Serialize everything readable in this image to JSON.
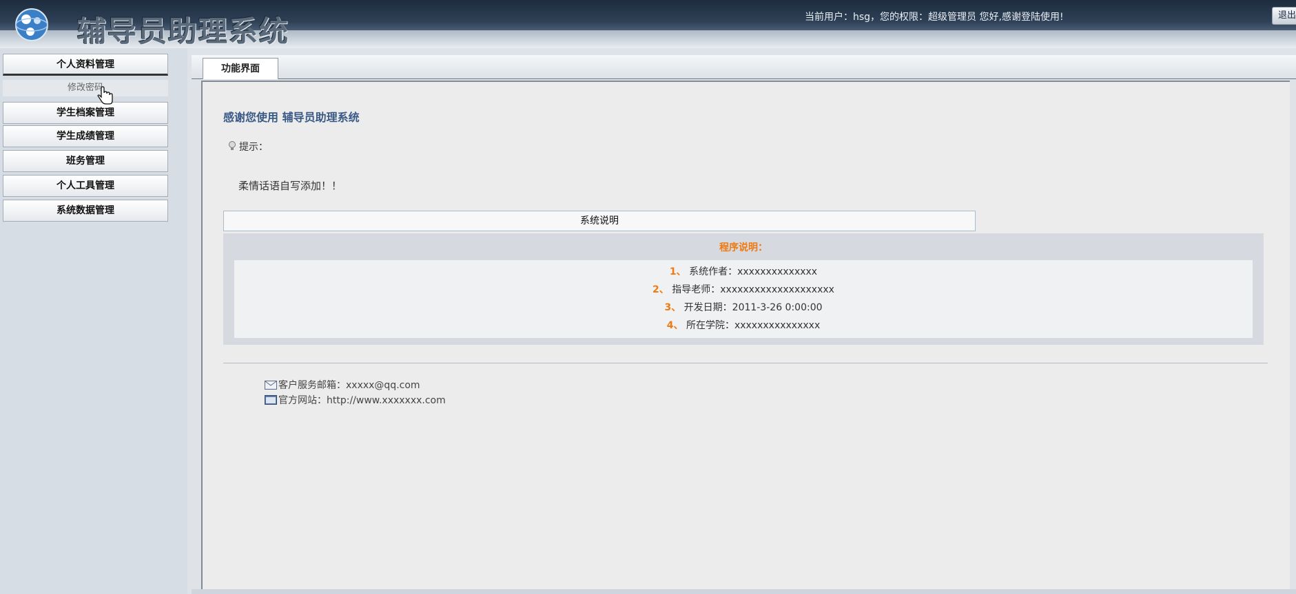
{
  "header": {
    "app_title": "辅导员助理系统",
    "user_info": "当前用户：hsg，您的权限：超级管理员 您好,感谢登陆使用!",
    "logout_label": "退出"
  },
  "sidebar": {
    "items": [
      {
        "label": "个人资料管理"
      },
      {
        "label": "学生档案管理"
      },
      {
        "label": "学生成绩管理"
      },
      {
        "label": "班务管理"
      },
      {
        "label": "个人工具管理"
      },
      {
        "label": "系统数据管理"
      }
    ],
    "sub_item": "修改密码"
  },
  "main": {
    "tab_label": "功能界面",
    "welcome": "感谢您使用  辅导员助理系统",
    "tip_label": "提示：",
    "tip_text": "柔情话语自写添加！！",
    "section_header": "系统说明",
    "program_title": "程序说明：",
    "program_lines": [
      {
        "num": "1、",
        "text": "系统作者：xxxxxxxxxxxxxx"
      },
      {
        "num": "2、",
        "text": "指导老师：xxxxxxxxxxxxxxxxxxxx"
      },
      {
        "num": "3、",
        "text": "开发日期：2011-3-26 0:00:00"
      },
      {
        "num": "4、",
        "text": "所在学院：xxxxxxxxxxxxxxx"
      }
    ],
    "contact": {
      "email": "客户服务邮箱：xxxxx@qq.com",
      "website": "官方网站：http://www.xxxxxxx.com"
    }
  },
  "colors": {
    "accent_orange": "#f07a10",
    "title_blue": "#3a5a86",
    "header_dark": "#1d2c3e"
  },
  "icons": [
    "globe-logo-icon",
    "bulb-icon",
    "envelope-icon",
    "website-icon",
    "hand-cursor-icon"
  ]
}
